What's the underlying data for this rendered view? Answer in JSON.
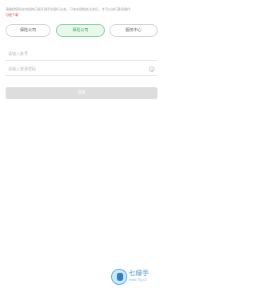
{
  "notice": {
    "text": "请确保您所在的机构已经开通手机银行业务，只有办理相关业务后，才可以进行登录操作",
    "link": "可使下载"
  },
  "tabs": [
    {
      "label": "保险公司",
      "active": false
    },
    {
      "label": "保险公司",
      "active": true
    },
    {
      "label": "服务中心",
      "active": false
    }
  ],
  "form": {
    "account_placeholder": "请输入账号",
    "password_placeholder": "请输入登录密码",
    "login_label": "登录"
  },
  "watermark": {
    "text": "七绿手",
    "url": "www.7lp.cn"
  },
  "colors": {
    "accent": "#3ba55c",
    "active_tab_bg": "#e9f8ed",
    "button_disabled": "#dddddd",
    "link": "#e53935"
  }
}
